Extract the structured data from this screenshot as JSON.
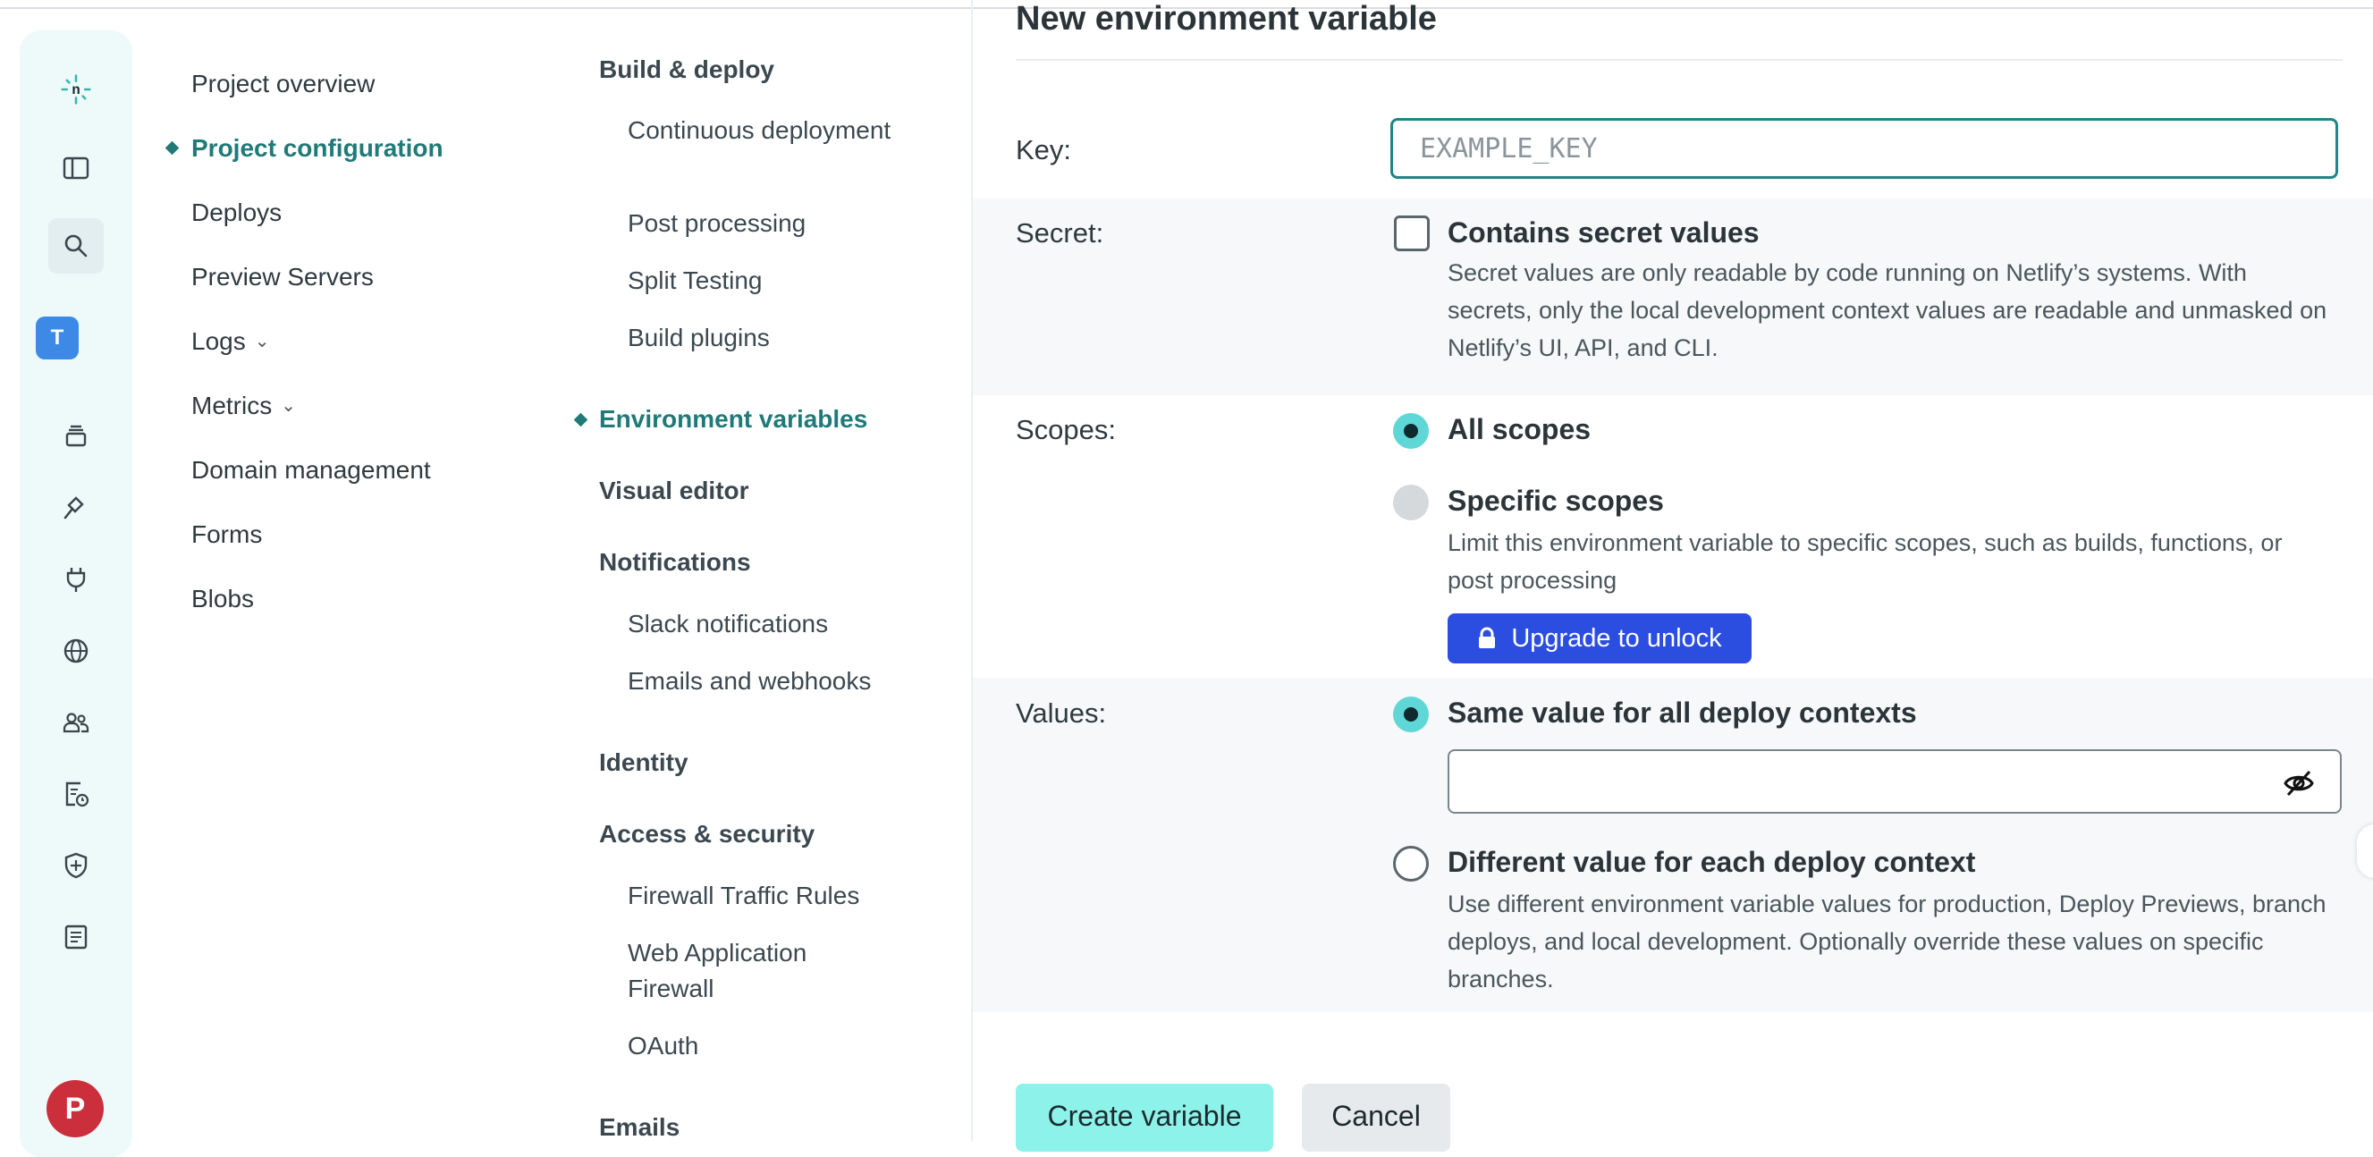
{
  "rail": {
    "team_initial": "T",
    "user_initial": "P",
    "icons": [
      "netlify-logo-icon",
      "sidebar-toggle-icon",
      "search-icon",
      "team-icon",
      "layers-icon",
      "hammer-icon",
      "plug-icon",
      "globe-icon",
      "users-icon",
      "billing-icon",
      "shield-icon",
      "docs-icon"
    ]
  },
  "nav1": {
    "items": [
      {
        "label": "Project overview"
      },
      {
        "label": "Project configuration"
      },
      {
        "label": "Deploys"
      },
      {
        "label": "Preview Servers"
      },
      {
        "label": "Logs"
      },
      {
        "label": "Metrics"
      },
      {
        "label": "Domain management"
      },
      {
        "label": "Forms"
      },
      {
        "label": "Blobs"
      }
    ],
    "active": "Project configuration"
  },
  "nav2": {
    "build_deploy": "Build & deploy",
    "continuous_deployment": "Continuous deployment",
    "post_processing": "Post processing",
    "split_testing": "Split Testing",
    "build_plugins": "Build plugins",
    "environment_variables": "Environment variables",
    "visual_editor": "Visual editor",
    "notifications": "Notifications",
    "slack_notifications": "Slack notifications",
    "emails_webhooks": "Emails and webhooks",
    "identity": "Identity",
    "access_security": "Access & security",
    "firewall_traffic_rules": "Firewall Traffic Rules",
    "web_application_firewall": "Web Application Firewall",
    "oauth": "OAuth",
    "emails": "Emails"
  },
  "form": {
    "title": "New environment variable",
    "key_label": "Key:",
    "key_placeholder": "EXAMPLE_KEY",
    "key_value": "",
    "secret_label": "Secret:",
    "secret_option": "Contains secret values",
    "secret_checked": false,
    "secret_desc": "Secret values are only readable by code running on Netlify’s systems. With secrets, only the local development context values are readable and unmasked on Netlify’s UI, API, and CLI.",
    "scopes_label": "Scopes:",
    "all_scopes": "All scopes",
    "specific_scopes": "Specific scopes",
    "specific_desc": "Limit this environment variable to specific scopes, such as builds, functions, or post processing",
    "upgrade_button": "Upgrade to unlock",
    "values_label": "Values:",
    "same_value": "Same value for all deploy contexts",
    "value_input": "",
    "different_value": "Different value for each deploy context",
    "different_desc": "Use different environment variable values for production, Deploy Previews, branch deploys, and local development. Optionally override these values on specific branches.",
    "create_button": "Create variable",
    "cancel_button": "Cancel"
  },
  "colors": {
    "accent": "#1f7a78",
    "radio_selected": "#5fd7d6",
    "upgrade": "#2c4ee0",
    "create_button": "#8cf2ea",
    "rail_bg": "#eef9fa"
  }
}
